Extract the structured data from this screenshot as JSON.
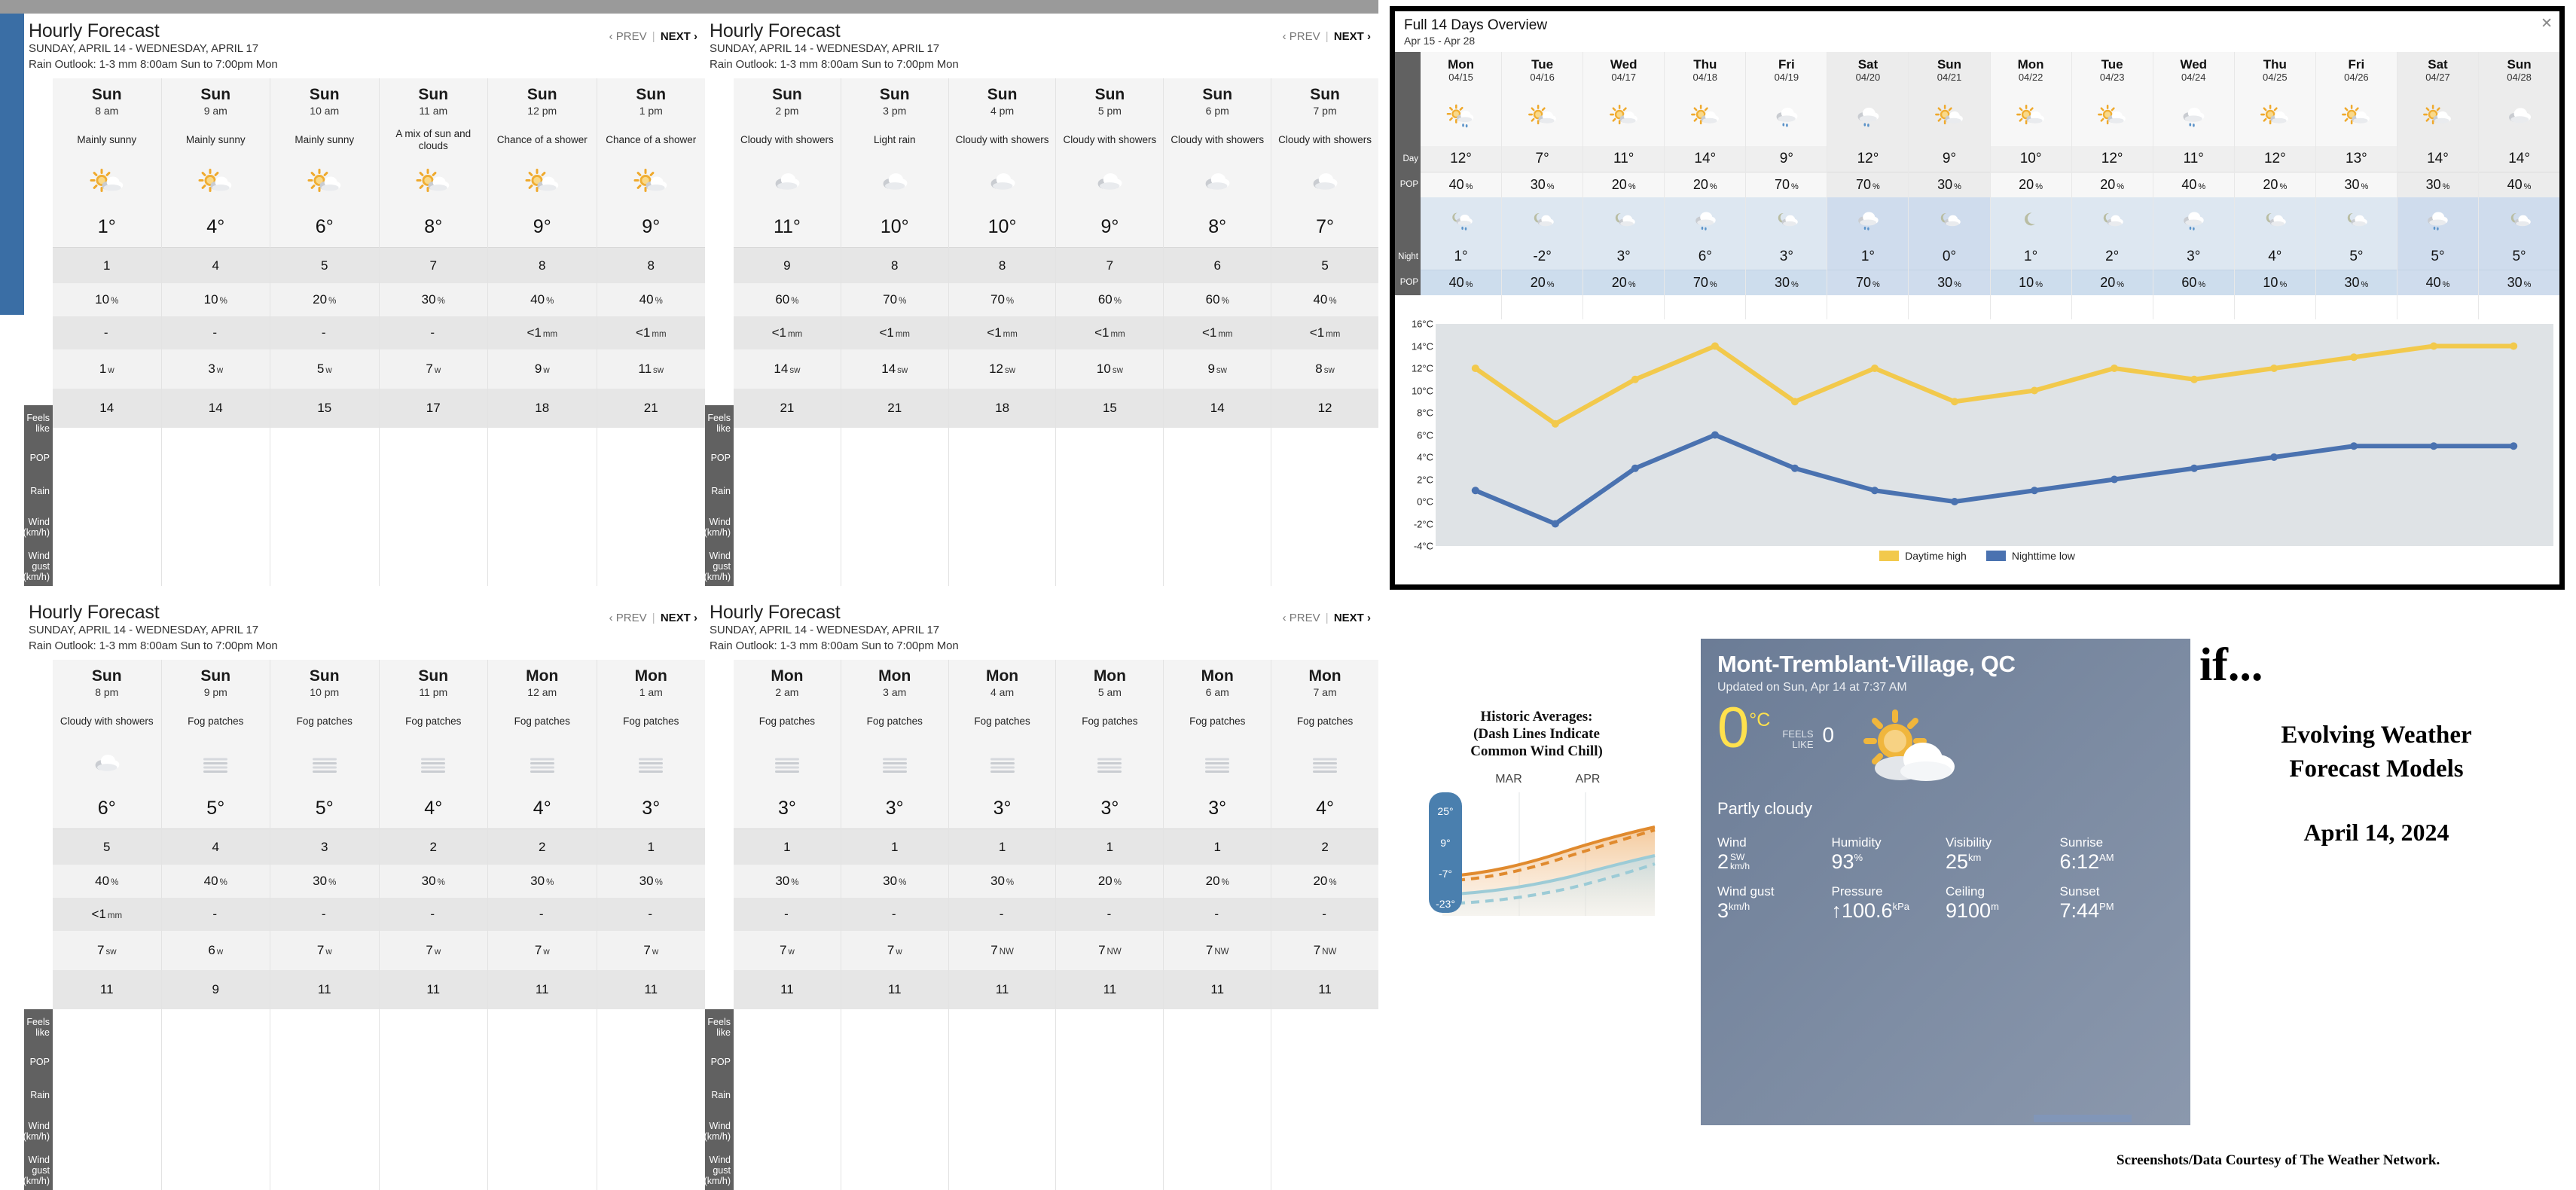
{
  "colors": {
    "accent_blue": "#3a6ea5",
    "daytime_high": "#f2c94c",
    "nighttime_low": "#4a72b0",
    "row_label_bg": "#616161",
    "night_band": "#dde7f1",
    "card_bg": "#7d8ca3"
  },
  "hourly_panels": [
    {
      "title": "Hourly Forecast",
      "date_range": "SUNDAY, APRIL 14 - WEDNESDAY, APRIL 17",
      "rain_outlook": "Rain Outlook: 1-3 mm 8:00am Sun to 7:00pm Mon",
      "prev_label": "‹ PREV",
      "sep": "|",
      "next_label": "NEXT ›",
      "row_labels": [
        "Feels like",
        "POP",
        "Rain",
        "Wind (km/h)",
        "Wind gust (km/h)"
      ],
      "columns": [
        {
          "day": "Sun",
          "hour": "8 am",
          "condition": "Mainly sunny",
          "icon": "sun-cloud-icon",
          "temp": "1°",
          "feels": "1",
          "pop": "10",
          "pop_unit": "%",
          "rain": "-",
          "rain_unit": "",
          "wind": "1",
          "wind_dir": "w",
          "gust": "14"
        },
        {
          "day": "Sun",
          "hour": "9 am",
          "condition": "Mainly sunny",
          "icon": "sun-cloud-icon",
          "temp": "4°",
          "feels": "4",
          "pop": "10",
          "pop_unit": "%",
          "rain": "-",
          "rain_unit": "",
          "wind": "3",
          "wind_dir": "w",
          "gust": "14"
        },
        {
          "day": "Sun",
          "hour": "10 am",
          "condition": "Mainly sunny",
          "icon": "sun-cloud-icon",
          "temp": "6°",
          "feels": "5",
          "pop": "20",
          "pop_unit": "%",
          "rain": "-",
          "rain_unit": "",
          "wind": "5",
          "wind_dir": "w",
          "gust": "15"
        },
        {
          "day": "Sun",
          "hour": "11 am",
          "condition": "A mix of sun and clouds",
          "icon": "sun-cloud-icon",
          "temp": "8°",
          "feels": "7",
          "pop": "30",
          "pop_unit": "%",
          "rain": "-",
          "rain_unit": "",
          "wind": "7",
          "wind_dir": "w",
          "gust": "17"
        },
        {
          "day": "Sun",
          "hour": "12 pm",
          "condition": "Chance of a shower",
          "icon": "sun-cloud-icon",
          "temp": "9°",
          "feels": "8",
          "pop": "40",
          "pop_unit": "%",
          "rain": "<1",
          "rain_unit": "mm",
          "wind": "9",
          "wind_dir": "w",
          "gust": "18"
        },
        {
          "day": "Sun",
          "hour": "1 pm",
          "condition": "Chance of a shower",
          "icon": "sun-cloud-icon",
          "temp": "9°",
          "feels": "8",
          "pop": "40",
          "pop_unit": "%",
          "rain": "<1",
          "rain_unit": "mm",
          "wind": "11",
          "wind_dir": "sw",
          "gust": "21"
        }
      ]
    },
    {
      "title": "Hourly Forecast",
      "date_range": "SUNDAY, APRIL 14 - WEDNESDAY, APRIL 17",
      "rain_outlook": "Rain Outlook: 1-3 mm 8:00am Sun to 7:00pm Mon",
      "prev_label": "‹ PREV",
      "sep": "|",
      "next_label": "NEXT ›",
      "row_labels": [
        "Feels like",
        "POP",
        "Rain",
        "Wind (km/h)",
        "Wind gust (km/h)"
      ],
      "columns": [
        {
          "day": "Sun",
          "hour": "2 pm",
          "condition": "Cloudy with showers",
          "icon": "rain-cloud-icon",
          "temp": "11°",
          "feels": "9",
          "pop": "60",
          "pop_unit": "%",
          "rain": "<1",
          "rain_unit": "mm",
          "wind": "14",
          "wind_dir": "sw",
          "gust": "21"
        },
        {
          "day": "Sun",
          "hour": "3 pm",
          "condition": "Light rain",
          "icon": "rain-cloud-icon",
          "temp": "10°",
          "feels": "8",
          "pop": "70",
          "pop_unit": "%",
          "rain": "<1",
          "rain_unit": "mm",
          "wind": "14",
          "wind_dir": "sw",
          "gust": "21"
        },
        {
          "day": "Sun",
          "hour": "4 pm",
          "condition": "Cloudy with showers",
          "icon": "rain-cloud-icon",
          "temp": "10°",
          "feels": "8",
          "pop": "70",
          "pop_unit": "%",
          "rain": "<1",
          "rain_unit": "mm",
          "wind": "12",
          "wind_dir": "sw",
          "gust": "18"
        },
        {
          "day": "Sun",
          "hour": "5 pm",
          "condition": "Cloudy with showers",
          "icon": "rain-cloud-icon",
          "temp": "9°",
          "feels": "7",
          "pop": "60",
          "pop_unit": "%",
          "rain": "<1",
          "rain_unit": "mm",
          "wind": "10",
          "wind_dir": "sw",
          "gust": "15"
        },
        {
          "day": "Sun",
          "hour": "6 pm",
          "condition": "Cloudy with showers",
          "icon": "rain-cloud-icon",
          "temp": "8°",
          "feels": "6",
          "pop": "60",
          "pop_unit": "%",
          "rain": "<1",
          "rain_unit": "mm",
          "wind": "9",
          "wind_dir": "sw",
          "gust": "14"
        },
        {
          "day": "Sun",
          "hour": "7 pm",
          "condition": "Cloudy with showers",
          "icon": "rain-cloud-icon",
          "temp": "7°",
          "feels": "5",
          "pop": "40",
          "pop_unit": "%",
          "rain": "<1",
          "rain_unit": "mm",
          "wind": "8",
          "wind_dir": "sw",
          "gust": "12"
        }
      ]
    },
    {
      "title": "Hourly Forecast",
      "date_range": "SUNDAY, APRIL 14 - WEDNESDAY, APRIL 17",
      "rain_outlook": "Rain Outlook: 1-3 mm 8:00am Sun to 7:00pm Mon",
      "prev_label": "‹ PREV",
      "sep": "|",
      "next_label": "NEXT ›",
      "row_labels": [
        "Feels like",
        "POP",
        "Rain",
        "Wind (km/h)",
        "Wind gust (km/h)"
      ],
      "columns": [
        {
          "day": "Sun",
          "hour": "8 pm",
          "condition": "Cloudy with showers",
          "icon": "rain-cloud-icon",
          "temp": "6°",
          "feels": "5",
          "pop": "40",
          "pop_unit": "%",
          "rain": "<1",
          "rain_unit": "mm",
          "wind": "7",
          "wind_dir": "sw",
          "gust": "11"
        },
        {
          "day": "Sun",
          "hour": "9 pm",
          "condition": "Fog patches",
          "icon": "fog-icon",
          "temp": "5°",
          "feels": "4",
          "pop": "40",
          "pop_unit": "%",
          "rain": "-",
          "rain_unit": "",
          "wind": "6",
          "wind_dir": "w",
          "gust": "9"
        },
        {
          "day": "Sun",
          "hour": "10 pm",
          "condition": "Fog patches",
          "icon": "fog-icon",
          "temp": "5°",
          "feels": "3",
          "pop": "30",
          "pop_unit": "%",
          "rain": "-",
          "rain_unit": "",
          "wind": "7",
          "wind_dir": "w",
          "gust": "11"
        },
        {
          "day": "Sun",
          "hour": "11 pm",
          "condition": "Fog patches",
          "icon": "fog-icon",
          "temp": "4°",
          "feels": "2",
          "pop": "30",
          "pop_unit": "%",
          "rain": "-",
          "rain_unit": "",
          "wind": "7",
          "wind_dir": "w",
          "gust": "11"
        },
        {
          "day": "Mon",
          "hour": "12 am",
          "condition": "Fog patches",
          "icon": "fog-icon",
          "temp": "4°",
          "feels": "2",
          "pop": "30",
          "pop_unit": "%",
          "rain": "-",
          "rain_unit": "",
          "wind": "7",
          "wind_dir": "w",
          "gust": "11"
        },
        {
          "day": "Mon",
          "hour": "1 am",
          "condition": "Fog patches",
          "icon": "fog-icon",
          "temp": "3°",
          "feels": "1",
          "pop": "30",
          "pop_unit": "%",
          "rain": "-",
          "rain_unit": "",
          "wind": "7",
          "wind_dir": "w",
          "gust": "11"
        }
      ]
    },
    {
      "title": "Hourly Forecast",
      "date_range": "SUNDAY, APRIL 14 - WEDNESDAY, APRIL 17",
      "rain_outlook": "Rain Outlook: 1-3 mm 8:00am Sun to 7:00pm Mon",
      "prev_label": "‹ PREV",
      "sep": "|",
      "next_label": "NEXT ›",
      "row_labels": [
        "Feels like",
        "POP",
        "Rain",
        "Wind (km/h)",
        "Wind gust (km/h)"
      ],
      "columns": [
        {
          "day": "Mon",
          "hour": "2 am",
          "condition": "Fog patches",
          "icon": "fog-icon",
          "temp": "3°",
          "feels": "1",
          "pop": "30",
          "pop_unit": "%",
          "rain": "-",
          "rain_unit": "",
          "wind": "7",
          "wind_dir": "w",
          "gust": "11"
        },
        {
          "day": "Mon",
          "hour": "3 am",
          "condition": "Fog patches",
          "icon": "fog-icon",
          "temp": "3°",
          "feels": "1",
          "pop": "30",
          "pop_unit": "%",
          "rain": "-",
          "rain_unit": "",
          "wind": "7",
          "wind_dir": "w",
          "gust": "11"
        },
        {
          "day": "Mon",
          "hour": "4 am",
          "condition": "Fog patches",
          "icon": "fog-icon",
          "temp": "3°",
          "feels": "1",
          "pop": "30",
          "pop_unit": "%",
          "rain": "-",
          "rain_unit": "",
          "wind": "7",
          "wind_dir": "NW",
          "gust": "11"
        },
        {
          "day": "Mon",
          "hour": "5 am",
          "condition": "Fog patches",
          "icon": "fog-icon",
          "temp": "3°",
          "feels": "1",
          "pop": "20",
          "pop_unit": "%",
          "rain": "-",
          "rain_unit": "",
          "wind": "7",
          "wind_dir": "NW",
          "gust": "11"
        },
        {
          "day": "Mon",
          "hour": "6 am",
          "condition": "Fog patches",
          "icon": "fog-icon",
          "temp": "3°",
          "feels": "1",
          "pop": "20",
          "pop_unit": "%",
          "rain": "-",
          "rain_unit": "",
          "wind": "7",
          "wind_dir": "NW",
          "gust": "11"
        },
        {
          "day": "Mon",
          "hour": "7 am",
          "condition": "Fog patches",
          "icon": "fog-icon",
          "temp": "4°",
          "feels": "2",
          "pop": "20",
          "pop_unit": "%",
          "rain": "-",
          "rain_unit": "",
          "wind": "7",
          "wind_dir": "NW",
          "gust": "11"
        }
      ]
    }
  ],
  "overview": {
    "title": "Full 14 Days Overview",
    "subtitle": "Apr 15 - Apr 28",
    "close_label": "✕",
    "row_labels": {
      "day": "Day",
      "day_pop": "POP",
      "night": "Night",
      "night_pop": "POP"
    },
    "days": [
      {
        "name": "Mon",
        "date": "04/15",
        "day_icon": "sun-cloud-rain-icon",
        "day_temp": "12°",
        "day_pop": "40",
        "night_icon": "moon-cloud-rain-icon",
        "night_temp": "1°",
        "night_pop": "40"
      },
      {
        "name": "Tue",
        "date": "04/16",
        "day_icon": "sun-cloud-icon",
        "day_temp": "7°",
        "day_pop": "30",
        "night_icon": "moon-cloud-icon",
        "night_temp": "-2°",
        "night_pop": "20"
      },
      {
        "name": "Wed",
        "date": "04/17",
        "day_icon": "sun-cloud-icon",
        "day_temp": "11°",
        "day_pop": "20",
        "night_icon": "moon-cloud-icon",
        "night_temp": "3°",
        "night_pop": "20"
      },
      {
        "name": "Thu",
        "date": "04/18",
        "day_icon": "sun-cloud-icon",
        "day_temp": "14°",
        "day_pop": "20",
        "night_icon": "cloud-rain-icon",
        "night_temp": "6°",
        "night_pop": "70"
      },
      {
        "name": "Fri",
        "date": "04/19",
        "day_icon": "cloud-rain-icon",
        "day_temp": "9°",
        "day_pop": "70",
        "night_icon": "moon-cloud-icon",
        "night_temp": "3°",
        "night_pop": "30"
      },
      {
        "name": "Sat",
        "date": "04/20",
        "day_icon": "cloud-rain-icon",
        "day_temp": "12°",
        "day_pop": "70",
        "night_icon": "cloud-rain-icon",
        "night_temp": "1°",
        "night_pop": "70"
      },
      {
        "name": "Sun",
        "date": "04/21",
        "day_icon": "sun-cloud-icon",
        "day_temp": "9°",
        "day_pop": "30",
        "night_icon": "moon-cloud-icon",
        "night_temp": "0°",
        "night_pop": "30"
      },
      {
        "name": "Mon",
        "date": "04/22",
        "day_icon": "sun-cloud-icon",
        "day_temp": "10°",
        "day_pop": "20",
        "night_icon": "moon-icon",
        "night_temp": "1°",
        "night_pop": "10"
      },
      {
        "name": "Tue",
        "date": "04/23",
        "day_icon": "sun-cloud-icon",
        "day_temp": "12°",
        "day_pop": "20",
        "night_icon": "moon-cloud-icon",
        "night_temp": "2°",
        "night_pop": "20"
      },
      {
        "name": "Wed",
        "date": "04/24",
        "day_icon": "cloud-rain-icon",
        "day_temp": "11°",
        "day_pop": "40",
        "night_icon": "cloud-rain-icon",
        "night_temp": "3°",
        "night_pop": "60"
      },
      {
        "name": "Thu",
        "date": "04/25",
        "day_icon": "sun-cloud-icon",
        "day_temp": "12°",
        "day_pop": "20",
        "night_icon": "moon-cloud-icon",
        "night_temp": "4°",
        "night_pop": "10"
      },
      {
        "name": "Fri",
        "date": "04/26",
        "day_icon": "sun-cloud-icon",
        "day_temp": "13°",
        "day_pop": "30",
        "night_icon": "moon-cloud-icon",
        "night_temp": "5°",
        "night_pop": "30"
      },
      {
        "name": "Sat",
        "date": "04/27",
        "day_icon": "sun-cloud-icon",
        "day_temp": "14°",
        "day_pop": "30",
        "night_icon": "cloud-rain-icon",
        "night_temp": "5°",
        "night_pop": "40"
      },
      {
        "name": "Sun",
        "date": "04/28",
        "day_icon": "cloud-icon",
        "day_temp": "14°",
        "day_pop": "40",
        "night_icon": "moon-cloud-icon",
        "night_temp": "5°",
        "night_pop": "30"
      }
    ],
    "pop_unit": "%"
  },
  "chart_data": {
    "type": "line",
    "title": "",
    "xlabel": "",
    "ylabel": "",
    "ylim": [
      -4,
      16
    ],
    "ytick_labels": [
      "16°C",
      "14°C",
      "12°C",
      "10°C",
      "8°C",
      "6°C",
      "4°C",
      "2°C",
      "0°C",
      "-2°C",
      "-4°C"
    ],
    "ytick_values": [
      16,
      14,
      12,
      10,
      8,
      6,
      4,
      2,
      0,
      -2,
      -4
    ],
    "grid": false,
    "legend_position": "bottom",
    "categories": [
      "04/15",
      "04/16",
      "04/17",
      "04/18",
      "04/19",
      "04/20",
      "04/21",
      "04/22",
      "04/23",
      "04/24",
      "04/25",
      "04/26",
      "04/27",
      "04/28"
    ],
    "series": [
      {
        "name": "Daytime high",
        "color": "#f2c94c",
        "values": [
          12,
          7,
          11,
          14,
          9,
          12,
          9,
          10,
          12,
          11,
          12,
          13,
          14,
          14
        ]
      },
      {
        "name": "Nighttime low",
        "color": "#4a72b0",
        "values": [
          1,
          -2,
          3,
          6,
          3,
          1,
          0,
          1,
          2,
          3,
          4,
          5,
          5,
          5
        ]
      }
    ]
  },
  "historic": {
    "title_lines": [
      "Historic Averages:",
      "(Dash Lines Indicate",
      "Common Wind Chill)"
    ],
    "months": [
      "MAR",
      "APR"
    ],
    "scale_labels": [
      "25°",
      "9°",
      "-7°",
      "-23°"
    ]
  },
  "current": {
    "city": "Mont-Tremblant-Village, QC",
    "updated": "Updated on Sun, Apr 14 at 7:37 AM",
    "temp": "0",
    "temp_unit": "°C",
    "feels_like_label_1": "FEELS",
    "feels_like_label_2": "LIKE",
    "feels_like_value": "0",
    "condition": "Partly cloudy",
    "icon": "sun-cloud-icon",
    "stats": [
      {
        "label": "Wind",
        "value": "2",
        "sup1": "SW",
        "sup2": "km/h",
        "stacked": true,
        "prefix": ""
      },
      {
        "label": "Humidity",
        "value": "93",
        "sup1": "%",
        "sup2": "",
        "stacked": false,
        "prefix": ""
      },
      {
        "label": "Visibility",
        "value": "25",
        "sup1": "km",
        "sup2": "",
        "stacked": false,
        "prefix": ""
      },
      {
        "label": "Sunrise",
        "value": "6:12",
        "sup1": "AM",
        "sup2": "",
        "stacked": false,
        "prefix": ""
      },
      {
        "label": "Wind gust",
        "value": "3",
        "sup1": "km/h",
        "sup2": "",
        "stacked": false,
        "prefix": ""
      },
      {
        "label": "Pressure",
        "value": "100.6",
        "sup1": "kPa",
        "sup2": "",
        "stacked": false,
        "prefix": "↑"
      },
      {
        "label": "Ceiling",
        "value": "9100",
        "sup1": "m",
        "sup2": "",
        "stacked": false,
        "prefix": ""
      },
      {
        "label": "Sunset",
        "value": "7:44",
        "sup1": "PM",
        "sup2": "",
        "stacked": false,
        "prefix": ""
      }
    ]
  },
  "slide_title": {
    "if_text": "if...",
    "headline_line1": "Evolving Weather",
    "headline_line2": "Forecast Models",
    "date": "April 14, 2024"
  },
  "footer": "Screenshots/Data Courtesy of The Weather Network."
}
